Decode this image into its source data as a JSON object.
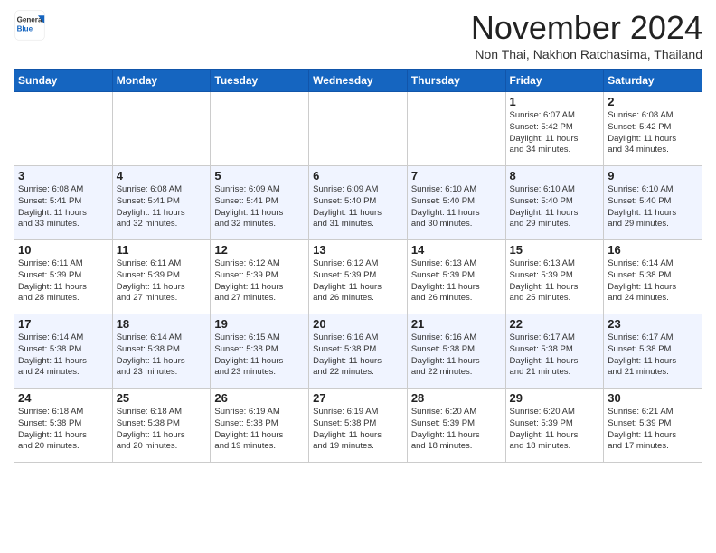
{
  "logo": {
    "general": "General",
    "blue": "Blue"
  },
  "title": "November 2024",
  "subtitle": "Non Thai, Nakhon Ratchasima, Thailand",
  "days_of_week": [
    "Sunday",
    "Monday",
    "Tuesday",
    "Wednesday",
    "Thursday",
    "Friday",
    "Saturday"
  ],
  "weeks": [
    [
      {
        "day": "",
        "info": ""
      },
      {
        "day": "",
        "info": ""
      },
      {
        "day": "",
        "info": ""
      },
      {
        "day": "",
        "info": ""
      },
      {
        "day": "",
        "info": ""
      },
      {
        "day": "1",
        "info": "Sunrise: 6:07 AM\nSunset: 5:42 PM\nDaylight: 11 hours\nand 34 minutes."
      },
      {
        "day": "2",
        "info": "Sunrise: 6:08 AM\nSunset: 5:42 PM\nDaylight: 11 hours\nand 34 minutes."
      }
    ],
    [
      {
        "day": "3",
        "info": "Sunrise: 6:08 AM\nSunset: 5:41 PM\nDaylight: 11 hours\nand 33 minutes."
      },
      {
        "day": "4",
        "info": "Sunrise: 6:08 AM\nSunset: 5:41 PM\nDaylight: 11 hours\nand 32 minutes."
      },
      {
        "day": "5",
        "info": "Sunrise: 6:09 AM\nSunset: 5:41 PM\nDaylight: 11 hours\nand 32 minutes."
      },
      {
        "day": "6",
        "info": "Sunrise: 6:09 AM\nSunset: 5:40 PM\nDaylight: 11 hours\nand 31 minutes."
      },
      {
        "day": "7",
        "info": "Sunrise: 6:10 AM\nSunset: 5:40 PM\nDaylight: 11 hours\nand 30 minutes."
      },
      {
        "day": "8",
        "info": "Sunrise: 6:10 AM\nSunset: 5:40 PM\nDaylight: 11 hours\nand 29 minutes."
      },
      {
        "day": "9",
        "info": "Sunrise: 6:10 AM\nSunset: 5:40 PM\nDaylight: 11 hours\nand 29 minutes."
      }
    ],
    [
      {
        "day": "10",
        "info": "Sunrise: 6:11 AM\nSunset: 5:39 PM\nDaylight: 11 hours\nand 28 minutes."
      },
      {
        "day": "11",
        "info": "Sunrise: 6:11 AM\nSunset: 5:39 PM\nDaylight: 11 hours\nand 27 minutes."
      },
      {
        "day": "12",
        "info": "Sunrise: 6:12 AM\nSunset: 5:39 PM\nDaylight: 11 hours\nand 27 minutes."
      },
      {
        "day": "13",
        "info": "Sunrise: 6:12 AM\nSunset: 5:39 PM\nDaylight: 11 hours\nand 26 minutes."
      },
      {
        "day": "14",
        "info": "Sunrise: 6:13 AM\nSunset: 5:39 PM\nDaylight: 11 hours\nand 26 minutes."
      },
      {
        "day": "15",
        "info": "Sunrise: 6:13 AM\nSunset: 5:39 PM\nDaylight: 11 hours\nand 25 minutes."
      },
      {
        "day": "16",
        "info": "Sunrise: 6:14 AM\nSunset: 5:38 PM\nDaylight: 11 hours\nand 24 minutes."
      }
    ],
    [
      {
        "day": "17",
        "info": "Sunrise: 6:14 AM\nSunset: 5:38 PM\nDaylight: 11 hours\nand 24 minutes."
      },
      {
        "day": "18",
        "info": "Sunrise: 6:14 AM\nSunset: 5:38 PM\nDaylight: 11 hours\nand 23 minutes."
      },
      {
        "day": "19",
        "info": "Sunrise: 6:15 AM\nSunset: 5:38 PM\nDaylight: 11 hours\nand 23 minutes."
      },
      {
        "day": "20",
        "info": "Sunrise: 6:16 AM\nSunset: 5:38 PM\nDaylight: 11 hours\nand 22 minutes."
      },
      {
        "day": "21",
        "info": "Sunrise: 6:16 AM\nSunset: 5:38 PM\nDaylight: 11 hours\nand 22 minutes."
      },
      {
        "day": "22",
        "info": "Sunrise: 6:17 AM\nSunset: 5:38 PM\nDaylight: 11 hours\nand 21 minutes."
      },
      {
        "day": "23",
        "info": "Sunrise: 6:17 AM\nSunset: 5:38 PM\nDaylight: 11 hours\nand 21 minutes."
      }
    ],
    [
      {
        "day": "24",
        "info": "Sunrise: 6:18 AM\nSunset: 5:38 PM\nDaylight: 11 hours\nand 20 minutes."
      },
      {
        "day": "25",
        "info": "Sunrise: 6:18 AM\nSunset: 5:38 PM\nDaylight: 11 hours\nand 20 minutes."
      },
      {
        "day": "26",
        "info": "Sunrise: 6:19 AM\nSunset: 5:38 PM\nDaylight: 11 hours\nand 19 minutes."
      },
      {
        "day": "27",
        "info": "Sunrise: 6:19 AM\nSunset: 5:38 PM\nDaylight: 11 hours\nand 19 minutes."
      },
      {
        "day": "28",
        "info": "Sunrise: 6:20 AM\nSunset: 5:39 PM\nDaylight: 11 hours\nand 18 minutes."
      },
      {
        "day": "29",
        "info": "Sunrise: 6:20 AM\nSunset: 5:39 PM\nDaylight: 11 hours\nand 18 minutes."
      },
      {
        "day": "30",
        "info": "Sunrise: 6:21 AM\nSunset: 5:39 PM\nDaylight: 11 hours\nand 17 minutes."
      }
    ]
  ]
}
